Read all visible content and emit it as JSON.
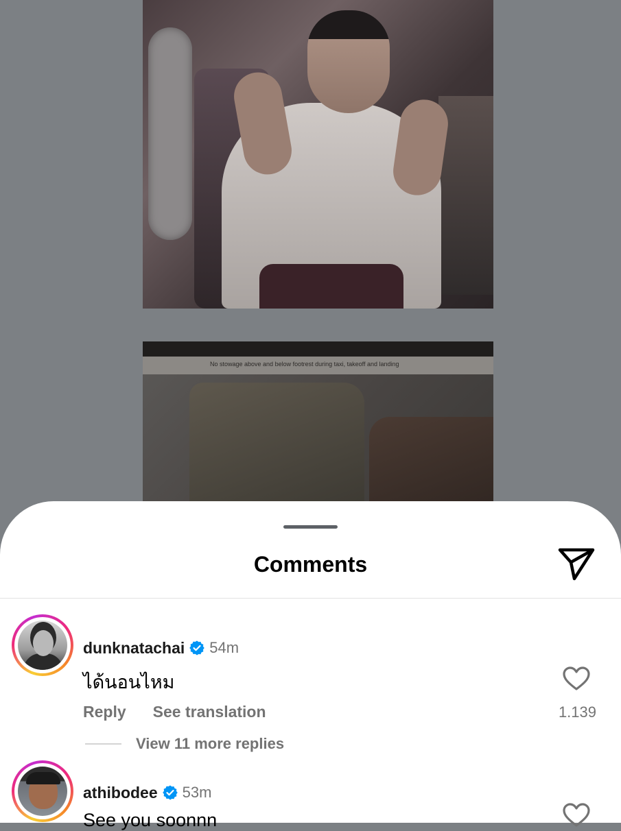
{
  "photo2_caption": "No stowage above and below footrest during taxi, takeoff and landing",
  "sheet": {
    "title": "Comments"
  },
  "comments": [
    {
      "username": "dunknatachai",
      "time": "54m",
      "text": "ได้นอนไหม",
      "reply_label": "Reply",
      "translate_label": "See translation",
      "likes": "1.139",
      "view_replies": "View 11 more replies"
    },
    {
      "username": "athibodee",
      "time": "53m",
      "text": "See you soonnn"
    }
  ],
  "colors": {
    "verified": "#0095f6",
    "secondary_text": "#737373"
  },
  "icons": [
    "share-send-icon",
    "verified-badge-icon",
    "heart-icon"
  ]
}
